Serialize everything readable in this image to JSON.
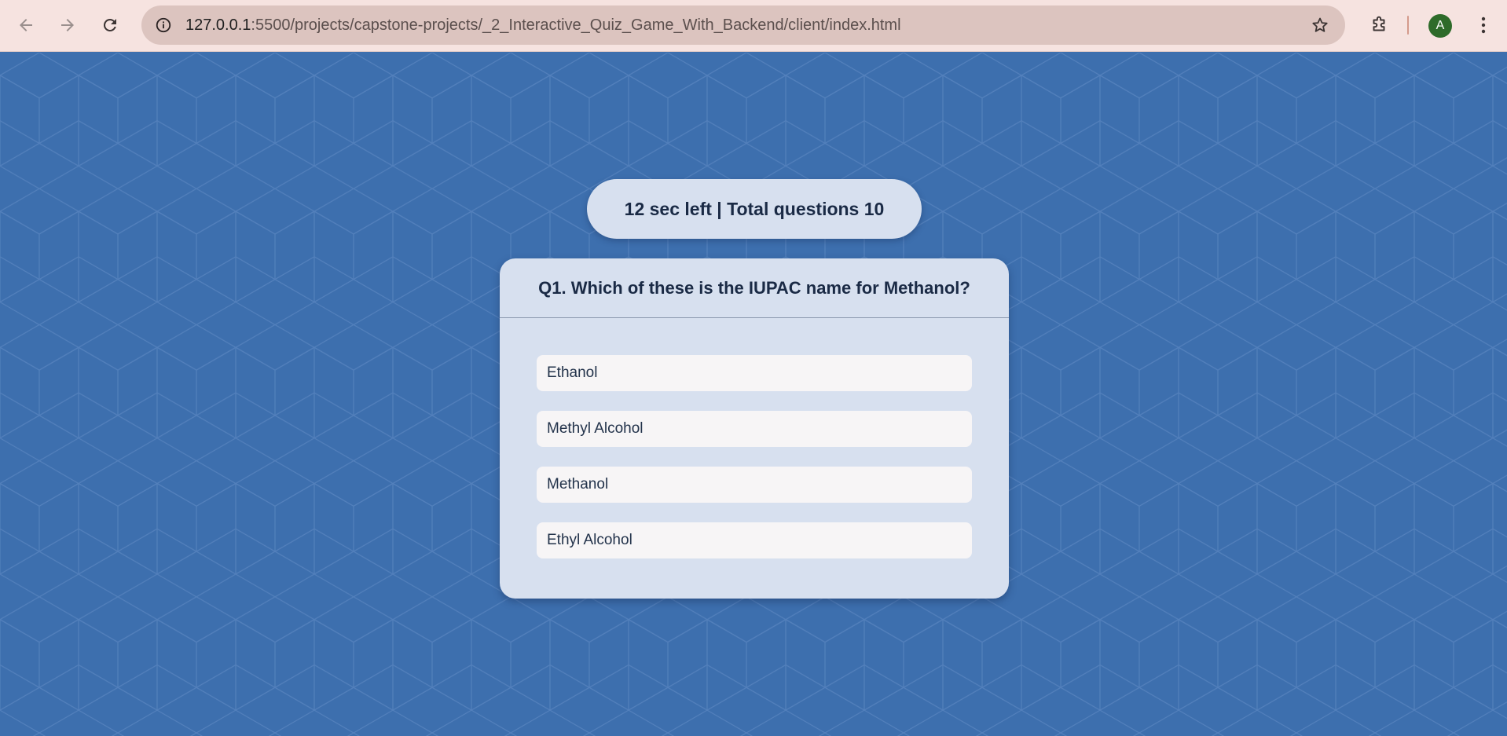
{
  "browser": {
    "url_host": "127.0.0.1",
    "url_rest": ":5500/projects/capstone-projects/_2_Interactive_Quiz_Game_With_Backend/client/index.html",
    "profile_initial": "A",
    "icons": {
      "back": "arrow-left-icon",
      "forward": "arrow-right-icon",
      "reload": "reload-icon",
      "site_info": "info-icon",
      "bookmark": "star-icon",
      "extensions": "puzzle-icon",
      "menu": "kebab-menu-icon"
    }
  },
  "quiz": {
    "status": "12 sec left | Total questions 10",
    "question": "Q1. Which of these is the IUPAC name for Methanol?",
    "options": [
      "Ethanol",
      "Methyl Alcohol",
      "Methanol",
      "Ethyl Alcohol"
    ]
  },
  "colors": {
    "page_background": "#3d6fae",
    "card_background": "#d7e0ef",
    "option_background": "#f7f5f6",
    "text_dark": "#1a2a45",
    "chrome_background": "#f6e3e0",
    "avatar_background": "#2e6b2a"
  }
}
